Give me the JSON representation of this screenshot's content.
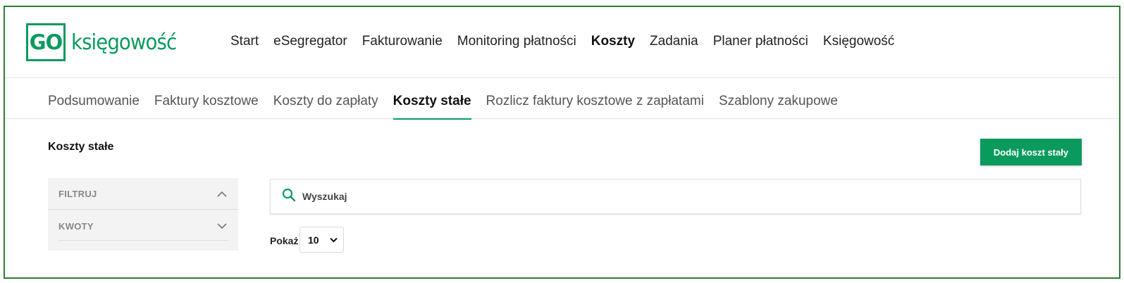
{
  "logo": {
    "box_text": "GO",
    "text": "księgowość"
  },
  "main_nav": {
    "items": [
      {
        "label": "Start"
      },
      {
        "label": "eSegregator"
      },
      {
        "label": "Fakturowanie"
      },
      {
        "label": "Monitoring płatności"
      },
      {
        "label": "Koszty",
        "active": true
      },
      {
        "label": "Zadania"
      },
      {
        "label": "Planer płatności"
      },
      {
        "label": "Księgowość"
      }
    ]
  },
  "sub_tabs": {
    "items": [
      {
        "label": "Podsumowanie"
      },
      {
        "label": "Faktury kosztowe"
      },
      {
        "label": "Koszty do zapłaty"
      },
      {
        "label": "Koszty stałe",
        "active": true
      },
      {
        "label": "Rozlicz faktury kosztowe z zapłatami"
      },
      {
        "label": "Szablony zakupowe"
      }
    ]
  },
  "page": {
    "title": "Koszty stałe",
    "add_button_label": "Dodaj koszt stały"
  },
  "filters": {
    "header_label": "FILTRUJ",
    "amounts_label": "KWOTY"
  },
  "search": {
    "placeholder": "Wyszukaj",
    "value": ""
  },
  "pagination": {
    "show_label": "Pokaż",
    "page_size": "10"
  },
  "colors": {
    "accent": "#0b9a5e",
    "frame": "#2e7d32"
  }
}
